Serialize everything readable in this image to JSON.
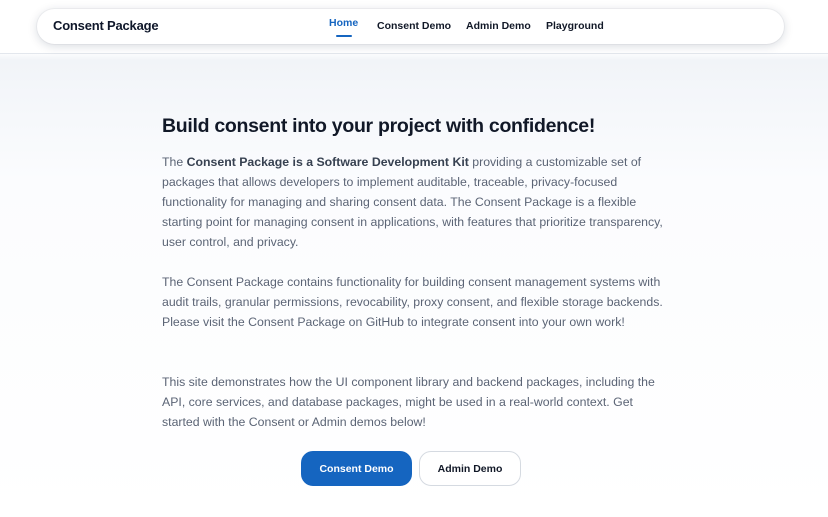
{
  "header": {
    "brand": "Consent Package",
    "nav": [
      {
        "label": "Home",
        "active": true
      },
      {
        "label": "Consent Demo",
        "active": false
      },
      {
        "label": "Admin Demo",
        "active": false
      },
      {
        "label": "Playground",
        "active": false
      }
    ]
  },
  "main": {
    "title": "Build consent into your project with confidence!",
    "p1_pre": "The ",
    "p1_bold": "Consent Package is a Software Development Kit",
    "p1_post": " providing a customizable set of packages that allows developers to implement auditable, traceable, privacy-focused functionality for managing and sharing consent data. The Consent Package is a flexible starting point for managing consent in applications, with features that prioritize transparency, user control, and privacy.",
    "p2": "The Consent Package contains functionality for building consent management systems with audit trails, granular permissions, revocability, proxy consent, and flexible storage backends. Please visit the Consent Package on GitHub to integrate consent into your own work!",
    "p3": "This site demonstrates how the UI component library and backend packages, including the API, core services, and database packages, might be used in a real-world context. Get started with the Consent or Admin demos below!",
    "buttons": {
      "consent_demo": "Consent Demo",
      "admin_demo": "Admin Demo"
    }
  },
  "colors": {
    "accent": "#1565c0",
    "text_dark": "#111827",
    "text_body": "#5b6475"
  }
}
